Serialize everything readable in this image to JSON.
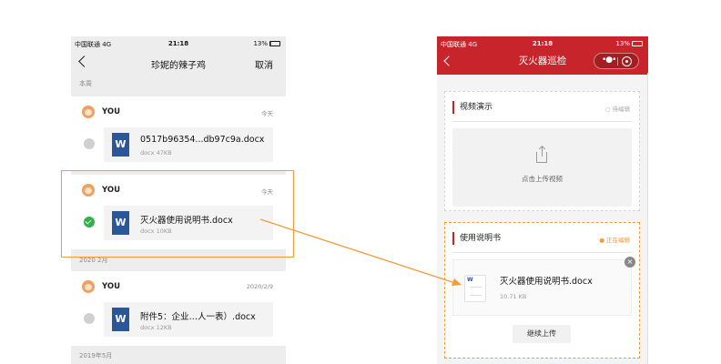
{
  "left_phone": {
    "status": {
      "carrier": "中国联通 4G",
      "time": "21:18",
      "battery": "13%",
      "battery_level": 0.13
    },
    "nav": {
      "title": "珍妮的辣子鸡",
      "cancel": "取消"
    },
    "sections": [
      {
        "label": "本周"
      },
      {
        "label": "2020 2月"
      },
      {
        "label": "2019年5月"
      }
    ],
    "messages": [
      {
        "sender": "YOU",
        "time": "今天",
        "file_name": "0517b96354...db97c9a.docx",
        "file_meta": "docx 47KB",
        "selected": false
      },
      {
        "sender": "YOU",
        "time": "今天",
        "file_name": "灭火器使用说明书.docx",
        "file_meta": "docx 10KB",
        "selected": true
      },
      {
        "sender": "YOU",
        "time": "2020/2/9",
        "file_name": "附件5：企业…人一表）.docx",
        "file_meta": "docx 12KB",
        "selected": false
      }
    ],
    "word_icon_letter": "W"
  },
  "right_phone": {
    "status": {
      "carrier": "中国联通 4G",
      "time": "21:18",
      "battery": "13%",
      "battery_level": 0.13
    },
    "nav": {
      "title": "灭火器巡检",
      "menu_icon": "more-dots-icon",
      "close_icon": "target-circle-icon"
    },
    "video_section": {
      "title": "视频演示",
      "status": "○ 待编辑",
      "upload_text": "点击上传视频"
    },
    "manual_section": {
      "title": "使用说明书",
      "status": "● 正在编辑",
      "file_name": "灭火器使用说明书.docx",
      "file_meta": "10.71 KB",
      "close_symbol": "×",
      "continue_button": "继续上传"
    }
  },
  "colors": {
    "accent_red": "#c8242b",
    "highlight_orange": "#f39a3b",
    "word_blue": "#2b579a",
    "check_green": "#2fb24a"
  }
}
